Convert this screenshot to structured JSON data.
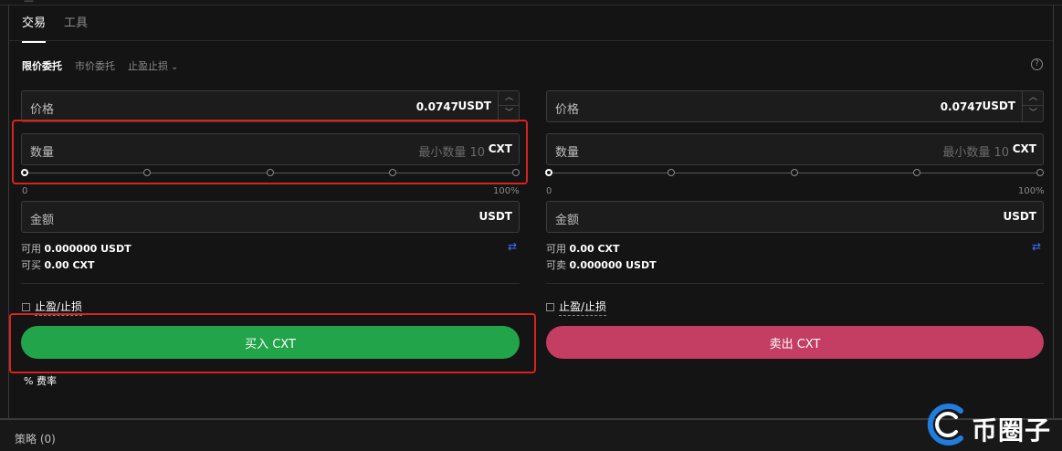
{
  "top_mark": "—",
  "tabs": [
    {
      "label": "交易",
      "active": true
    },
    {
      "label": "工具",
      "active": false
    }
  ],
  "order_types": {
    "limit": "限价委托",
    "market": "市价委托",
    "stop": "止盈止损"
  },
  "buy": {
    "price_label": "价格",
    "price_value": "0.0747",
    "price_unit": "USDT",
    "qty_label": "数量",
    "qty_placeholder": "最小数量 10",
    "qty_unit": "CXT",
    "slider_min": "0",
    "slider_max": "100%",
    "amount_label": "金额",
    "amount_unit": "USDT",
    "avail_label": "可用",
    "avail_value": "0.000000 USDT",
    "can_label": "可买",
    "can_value": "0.00 CXT",
    "tpsl_label": "止盈/止损",
    "button_label": "买入 CXT"
  },
  "sell": {
    "price_label": "价格",
    "price_value": "0.0747",
    "price_unit": "USDT",
    "qty_label": "数量",
    "qty_placeholder": "最小数量 10",
    "qty_unit": "CXT",
    "slider_min": "0",
    "slider_max": "100%",
    "amount_label": "金额",
    "amount_unit": "USDT",
    "avail_label": "可用",
    "avail_value": "0.00 CXT",
    "can_label": "可卖",
    "can_value": "0.000000 USDT",
    "tpsl_label": "止盈/止损",
    "button_label": "卖出 CXT"
  },
  "fee_label": "% 费率",
  "strategy_label": "策略 (0)",
  "watermark_text": "币圈子",
  "colors": {
    "buy": "#22a44a",
    "sell": "#c43d62",
    "accent": "#3d6eff",
    "highlight": "#d8221c"
  },
  "icons": [
    "help-icon",
    "chevron-down-icon",
    "swap-icon",
    "more-icon",
    "stepper-up-icon",
    "stepper-down-icon"
  ]
}
